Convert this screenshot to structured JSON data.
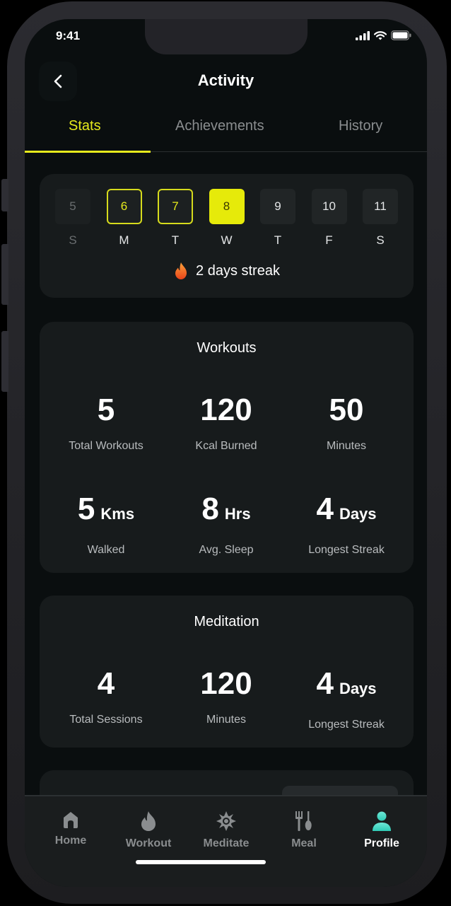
{
  "status_bar": {
    "time": "9:41"
  },
  "header": {
    "title": "Activity",
    "back_icon": "chevron-left-icon"
  },
  "tabs": [
    {
      "label": "Stats",
      "active": true
    },
    {
      "label": "Achievements",
      "active": false
    },
    {
      "label": "History",
      "active": false
    }
  ],
  "calendar": {
    "days": [
      {
        "date": "5",
        "letter": "S",
        "state": "past"
      },
      {
        "date": "6",
        "letter": "M",
        "state": "done"
      },
      {
        "date": "7",
        "letter": "T",
        "state": "done"
      },
      {
        "date": "8",
        "letter": "W",
        "state": "today"
      },
      {
        "date": "9",
        "letter": "T",
        "state": "future"
      },
      {
        "date": "10",
        "letter": "F",
        "state": "future"
      },
      {
        "date": "11",
        "letter": "S",
        "state": "future"
      }
    ],
    "streak_icon": "fire-icon",
    "streak_text": "2 days streak"
  },
  "workouts": {
    "title": "Workouts",
    "stats": [
      {
        "value": "5",
        "unit": "",
        "label": "Total Workouts"
      },
      {
        "value": "120",
        "unit": "",
        "label": "Kcal Burned"
      },
      {
        "value": "50",
        "unit": "",
        "label": "Minutes"
      },
      {
        "value": "5",
        "unit": "Kms",
        "label": "Walked"
      },
      {
        "value": "8",
        "unit": "Hrs",
        "label": "Avg. Sleep"
      },
      {
        "value": "4",
        "unit": "Days",
        "label": "Longest Streak"
      }
    ]
  },
  "meditation": {
    "title": "Meditation",
    "stats": [
      {
        "value": "4",
        "unit": "",
        "label": "Total Sessions"
      },
      {
        "value": "120",
        "unit": "",
        "label": "Minutes"
      },
      {
        "value": "4",
        "unit": "Days",
        "label": "Longest Streak"
      }
    ]
  },
  "bottom_nav": [
    {
      "label": "Home",
      "icon": "home-icon",
      "active": false
    },
    {
      "label": "Workout",
      "icon": "flame-icon",
      "active": false
    },
    {
      "label": "Meditate",
      "icon": "lotus-icon",
      "active": false
    },
    {
      "label": "Meal",
      "icon": "fork-spoon-icon",
      "active": false
    },
    {
      "label": "Profile",
      "icon": "person-icon",
      "active": true
    }
  ],
  "colors": {
    "accent": "#e6ea1c",
    "background": "#0a0e0f",
    "card": "#171b1c",
    "profile_active": "#3fd9c4"
  }
}
